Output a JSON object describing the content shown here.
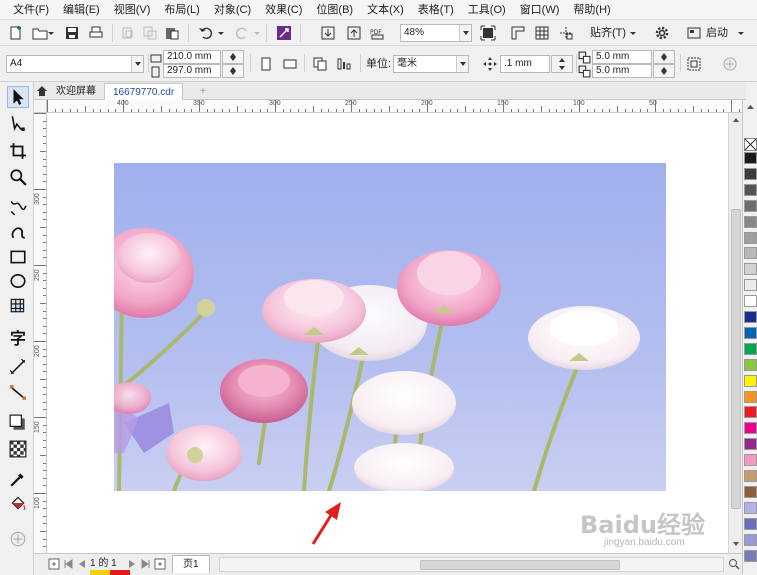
{
  "menu": [
    "文件(F)",
    "编辑(E)",
    "视图(V)",
    "布局(L)",
    "对象(C)",
    "效果(C)",
    "位图(B)",
    "文本(X)",
    "表格(T)",
    "工具(O)",
    "窗口(W)",
    "帮助(H)"
  ],
  "toolbar": {
    "zoom_value": "48%",
    "snap_label": "贴齐(T)",
    "launch_label": "启动",
    "pdf_label": "PDF"
  },
  "properties": {
    "page_size": "A4",
    "width": "210.0 mm",
    "height": "297.0 mm",
    "units_label": "单位:",
    "units_value": "毫米",
    "nudge": ".1 mm",
    "dup_x": "5.0 mm",
    "dup_y": "5.0 mm"
  },
  "tabs": {
    "welcome": "欢迎屏幕",
    "document": "16679770.cdr",
    "add": "+"
  },
  "ruler": {
    "h_labels": [
      "400",
      "350",
      "300",
      "250",
      "200",
      "150",
      "100",
      "50"
    ],
    "v_labels": [
      "300",
      "250",
      "200",
      "150",
      "100"
    ],
    "unit": "毫米"
  },
  "tools": [
    "pick-tool",
    "shape-tool",
    "crop-tool",
    "zoom-tool",
    "freehand-tool",
    "artistic-media-tool",
    "rectangle-tool",
    "ellipse-tool",
    "polygon-tool",
    "text-tool",
    "parallel-dimension-tool",
    "connector-tool",
    "drop-shadow-tool",
    "transparency-tool",
    "eyedropper-tool",
    "interactive-fill-tool",
    "add-tool"
  ],
  "palette": [
    "#1a1a1a",
    "#3c3c3c",
    "#555555",
    "#6e6e6e",
    "#878787",
    "#a0a0a0",
    "#b9b9b9",
    "#d2d2d2",
    "#ebebeb",
    "#ffffff",
    "#1a2f8c",
    "#0065b3",
    "#00a651",
    "#8cc63f",
    "#fff200",
    "#f7941d",
    "#ed1c24",
    "#ec008c",
    "#92278f",
    "#f49ac2",
    "#c69c6d",
    "#8b5e3c",
    "#b3b3e6",
    "#6d6dbf",
    "#9999d9",
    "#7a7ab8"
  ],
  "bottom": {
    "page_count": "1 的 1",
    "page_tab": "页1"
  },
  "watermark": {
    "brand": "Baidu经验",
    "url": "jingyan.baidu.com"
  }
}
